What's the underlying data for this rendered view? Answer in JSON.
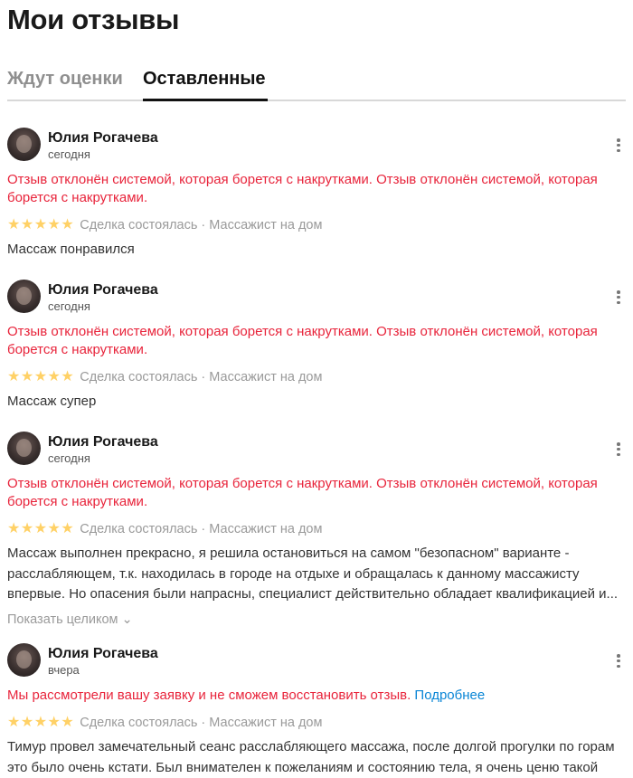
{
  "page_title": "Мои отзывы",
  "tabs": [
    {
      "label": "Ждут оценки",
      "active": false
    },
    {
      "label": "Оставленные",
      "active": true
    }
  ],
  "colors": {
    "alert": "#e8243b",
    "link": "#0a86d6",
    "stars": "#ffd166"
  },
  "reviews": [
    {
      "author": "Юлия Рогачева",
      "date": "сегодня",
      "alert": "Отзыв отклонён системой, которая борется с накрутками. Отзыв отклонён системой, которая борется с накрутками.",
      "alert_link": "",
      "rating": 5,
      "stars_text": "★★★★★",
      "meta": "Сделка состоялась · Массажист на дом",
      "text": "Массаж понравился",
      "expand_label": ""
    },
    {
      "author": "Юлия Рогачева",
      "date": "сегодня",
      "alert": "Отзыв отклонён системой, которая борется с накрутками. Отзыв отклонён системой, которая борется с накрутками.",
      "alert_link": "",
      "rating": 5,
      "stars_text": "★★★★★",
      "meta": "Сделка состоялась · Массажист на дом",
      "text": "Массаж супер",
      "expand_label": ""
    },
    {
      "author": "Юлия Рогачева",
      "date": "сегодня",
      "alert": "Отзыв отклонён системой, которая борется с накрутками. Отзыв отклонён системой, которая борется с накрутками.",
      "alert_link": "",
      "rating": 5,
      "stars_text": "★★★★★",
      "meta": "Сделка состоялась · Массажист на дом",
      "text": "Массаж выполнен прекрасно, я решила остановиться на самом \"безопасном\" варианте - расслабляющем, т.к. находилась в городе на отдыхе и обращалась к данному массажисту впервые. Но опасения были напрасны, специалист действительно обладает квалификацией и...",
      "expand_label": "Показать целиком ⌄"
    },
    {
      "author": "Юлия Рогачева",
      "date": "вчера",
      "alert": "Мы рассмотрели вашу заявку и не сможем восстановить отзыв. ",
      "alert_link": "Подробнее",
      "rating": 5,
      "stars_text": "★★★★★",
      "meta": "Сделка состоялась · Массажист на дом",
      "text": "Тимур провел замечательный сеанс расслабляющего массажа, после долгой прогулки по горам это было очень кстати. Был внимателен к пожеланиям и состоянию тела, я очень ценю такой",
      "expand_label": ""
    }
  ]
}
